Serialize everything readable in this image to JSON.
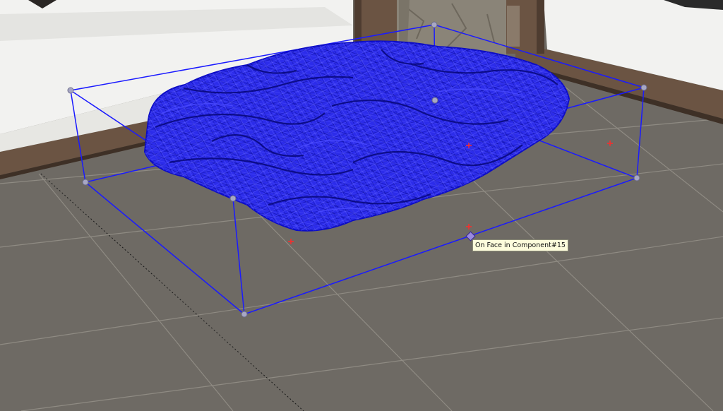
{
  "viewport": {
    "inference_tooltip": "On Face in Component#15"
  },
  "colors": {
    "selection": "#1a1aff",
    "mesh_fill": "#2a2ae8",
    "floor": "#6e6a64",
    "sofa": "#f2f2f0",
    "wood": "#6b5443",
    "pillar": "#8a8478",
    "marker": "#ff2a2a",
    "tooltip_bg": "#fdfcdc"
  },
  "icons": [
    "grip-icon",
    "midpoint-marker-icon",
    "inference-point-icon"
  ]
}
